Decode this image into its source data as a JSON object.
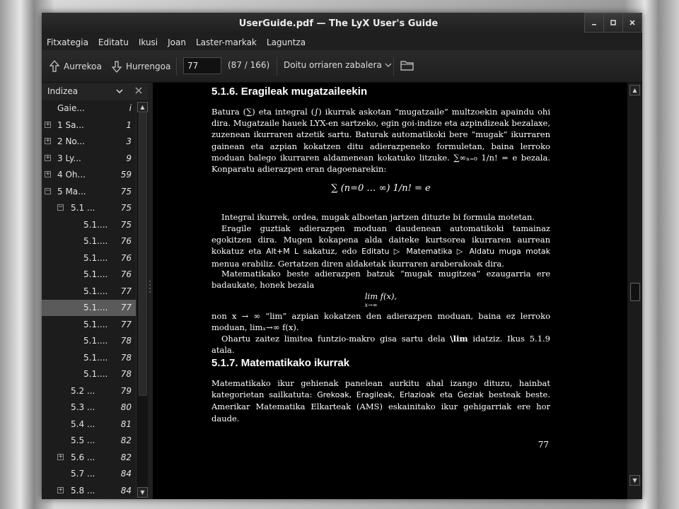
{
  "window": {
    "title": "UserGuide.pdf — The LyX User's Guide"
  },
  "menu": [
    "Fitxategia",
    "Editatu",
    "Ikusi",
    "Joan",
    "Laster-markak",
    "Laguntza"
  ],
  "toolbar": {
    "prev_label": "Aurrekoa",
    "next_label": "Hurrengoa",
    "page_value": "77",
    "page_count": "(87 / 166)",
    "zoom_label": "Doitu orriaren zabalera"
  },
  "sidebar": {
    "mode": "Indizea",
    "header_label": "Gaie...",
    "header_page": "i",
    "items": [
      {
        "label": "1 Sa...",
        "page": "1",
        "level": 0,
        "exp": "+"
      },
      {
        "label": "2 No...",
        "page": "3",
        "level": 0,
        "exp": "+"
      },
      {
        "label": "3 Ly...",
        "page": "9",
        "level": 0,
        "exp": "+"
      },
      {
        "label": "4 Oh...",
        "page": "59",
        "level": 0,
        "exp": "+"
      },
      {
        "label": "5 Ma...",
        "page": "75",
        "level": 0,
        "exp": "-"
      },
      {
        "label": "5.1 ...",
        "page": "75",
        "level": 1,
        "exp": "-"
      },
      {
        "label": "5.1....",
        "page": "75",
        "level": 2,
        "exp": ""
      },
      {
        "label": "5.1....",
        "page": "76",
        "level": 2,
        "exp": ""
      },
      {
        "label": "5.1....",
        "page": "76",
        "level": 2,
        "exp": ""
      },
      {
        "label": "5.1....",
        "page": "76",
        "level": 2,
        "exp": ""
      },
      {
        "label": "5.1....",
        "page": "77",
        "level": 2,
        "exp": ""
      },
      {
        "label": "5.1....",
        "page": "77",
        "level": 2,
        "exp": "",
        "selected": true
      },
      {
        "label": "5.1....",
        "page": "77",
        "level": 2,
        "exp": ""
      },
      {
        "label": "5.1....",
        "page": "78",
        "level": 2,
        "exp": ""
      },
      {
        "label": "5.1....",
        "page": "78",
        "level": 2,
        "exp": ""
      },
      {
        "label": "5.1....",
        "page": "78",
        "level": 2,
        "exp": ""
      },
      {
        "label": "5.2 ...",
        "page": "79",
        "level": 1,
        "exp": ""
      },
      {
        "label": "5.3 ...",
        "page": "80",
        "level": 1,
        "exp": ""
      },
      {
        "label": "5.4 ...",
        "page": "81",
        "level": 1,
        "exp": ""
      },
      {
        "label": "5.5 ...",
        "page": "82",
        "level": 1,
        "exp": ""
      },
      {
        "label": "5.6 ...",
        "page": "82",
        "level": 1,
        "exp": "+"
      },
      {
        "label": "5.7 ...",
        "page": "84",
        "level": 1,
        "exp": ""
      },
      {
        "label": "5.8 ...",
        "page": "84",
        "level": 1,
        "exp": "+"
      }
    ]
  },
  "document": {
    "h1": "5.1.6. Eragileak mugatzaileekin",
    "p1": "Batura (∑) eta integral (∫) ikurrak askotan “mugatzaile” multzoekin apaindu ohi dira. Mugatzaile hauek LYX-en sartzeko, egin goi-indize eta azpindizeak bezalaxe, zuzenean ikurraren atzetik sartu. Baturak automatikoki bere “mugak” ikurraren gainean eta azpian kokatzen ditu adierazpeneko formuletan, baina lerroko moduan balego ikurraren aldamenean kokatuko litzuke. ∑∞ₙ₌₀ 1/n! = e bezala. Konparatu adierazpen eran dagoenarekin:",
    "eq1": "∑ (n=0 … ∞)  1/n!  = e",
    "p2": "Integral ikurrek, ordea, mugak alboetan jartzen dituzte bi formula motetan.",
    "p3a": "Eragile guztiak adierazpen moduan daudenean automatikoki tamainaz egokitzen dira. Mugen kokapena alda daiteke kurtsorea ikurraren aurrean kokatuz eta ",
    "p3_key": "Alt+M L",
    "p3b": " sakatuz, edo ",
    "p3_menu": "Editatu ▷ Matematika ▷ Aldatu muga motak",
    "p3c": " menua erabiliz. Gertatzen diren aldaketak ikurraren araberakoak dira.",
    "p4": "Matematikako beste adierazpen batzuk “mugak mugitzea” ezaugarria ere badaukate, honek bezala",
    "eq2": "lim f(x),",
    "eq2_sub": "x→∞",
    "p5": "non x → ∞ “lim” azpian kokatzen den adierazpen moduan, baina ez lerroko moduan, limₓ→∞ f(x).",
    "p6a": "Ohartu zaitez limitea funtzio-makro gisa sartu dela ",
    "p6_cmd": "\\lim",
    "p6b": " idatziz. Ikus 5.1.9 atala.",
    "h2": "5.1.7. Matematikako ikurrak",
    "p7a": "Matematikako ikur gehienak panelean aurkitu ahal izango dituzu, hainbat kategorietan sailkatuta: ",
    "p7_cats": "Grekoak, Eragileak, Erlazioak",
    "p7_eta": " eta ",
    "p7_cat4": "Geziak",
    "p7b": " besteak beste. Amerikar Matematika Elkarteak (AMS) eskainitako ikur gehigarriak ere hor daude.",
    "page_number": "77"
  }
}
